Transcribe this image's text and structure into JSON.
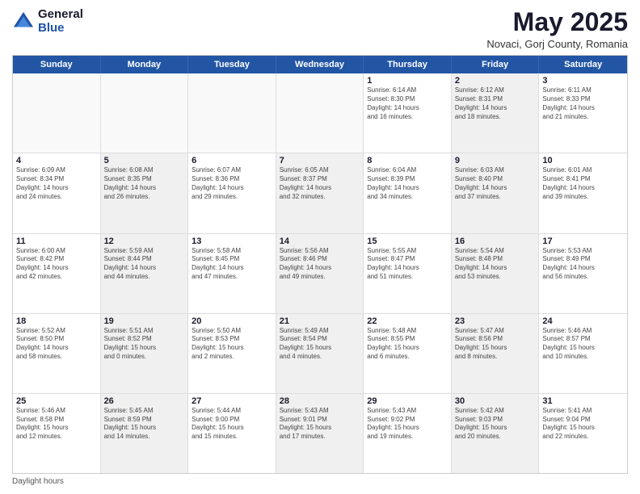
{
  "logo": {
    "general": "General",
    "blue": "Blue"
  },
  "header": {
    "month": "May 2025",
    "location": "Novaci, Gorj County, Romania"
  },
  "weekdays": [
    "Sunday",
    "Monday",
    "Tuesday",
    "Wednesday",
    "Thursday",
    "Friday",
    "Saturday"
  ],
  "footer": {
    "daylight_label": "Daylight hours"
  },
  "weeks": [
    [
      {
        "day": "",
        "info": "",
        "empty": true
      },
      {
        "day": "",
        "info": "",
        "empty": true
      },
      {
        "day": "",
        "info": "",
        "empty": true
      },
      {
        "day": "",
        "info": "",
        "empty": true
      },
      {
        "day": "1",
        "info": "Sunrise: 6:14 AM\nSunset: 8:30 PM\nDaylight: 14 hours\nand 16 minutes.",
        "empty": false,
        "shaded": false
      },
      {
        "day": "2",
        "info": "Sunrise: 6:12 AM\nSunset: 8:31 PM\nDaylight: 14 hours\nand 18 minutes.",
        "empty": false,
        "shaded": true
      },
      {
        "day": "3",
        "info": "Sunrise: 6:11 AM\nSunset: 8:33 PM\nDaylight: 14 hours\nand 21 minutes.",
        "empty": false,
        "shaded": false
      }
    ],
    [
      {
        "day": "4",
        "info": "Sunrise: 6:09 AM\nSunset: 8:34 PM\nDaylight: 14 hours\nand 24 minutes.",
        "empty": false,
        "shaded": false
      },
      {
        "day": "5",
        "info": "Sunrise: 6:08 AM\nSunset: 8:35 PM\nDaylight: 14 hours\nand 26 minutes.",
        "empty": false,
        "shaded": true
      },
      {
        "day": "6",
        "info": "Sunrise: 6:07 AM\nSunset: 8:36 PM\nDaylight: 14 hours\nand 29 minutes.",
        "empty": false,
        "shaded": false
      },
      {
        "day": "7",
        "info": "Sunrise: 6:05 AM\nSunset: 8:37 PM\nDaylight: 14 hours\nand 32 minutes.",
        "empty": false,
        "shaded": true
      },
      {
        "day": "8",
        "info": "Sunrise: 6:04 AM\nSunset: 8:39 PM\nDaylight: 14 hours\nand 34 minutes.",
        "empty": false,
        "shaded": false
      },
      {
        "day": "9",
        "info": "Sunrise: 6:03 AM\nSunset: 8:40 PM\nDaylight: 14 hours\nand 37 minutes.",
        "empty": false,
        "shaded": true
      },
      {
        "day": "10",
        "info": "Sunrise: 6:01 AM\nSunset: 8:41 PM\nDaylight: 14 hours\nand 39 minutes.",
        "empty": false,
        "shaded": false
      }
    ],
    [
      {
        "day": "11",
        "info": "Sunrise: 6:00 AM\nSunset: 8:42 PM\nDaylight: 14 hours\nand 42 minutes.",
        "empty": false,
        "shaded": false
      },
      {
        "day": "12",
        "info": "Sunrise: 5:59 AM\nSunset: 8:44 PM\nDaylight: 14 hours\nand 44 minutes.",
        "empty": false,
        "shaded": true
      },
      {
        "day": "13",
        "info": "Sunrise: 5:58 AM\nSunset: 8:45 PM\nDaylight: 14 hours\nand 47 minutes.",
        "empty": false,
        "shaded": false
      },
      {
        "day": "14",
        "info": "Sunrise: 5:56 AM\nSunset: 8:46 PM\nDaylight: 14 hours\nand 49 minutes.",
        "empty": false,
        "shaded": true
      },
      {
        "day": "15",
        "info": "Sunrise: 5:55 AM\nSunset: 8:47 PM\nDaylight: 14 hours\nand 51 minutes.",
        "empty": false,
        "shaded": false
      },
      {
        "day": "16",
        "info": "Sunrise: 5:54 AM\nSunset: 8:48 PM\nDaylight: 14 hours\nand 53 minutes.",
        "empty": false,
        "shaded": true
      },
      {
        "day": "17",
        "info": "Sunrise: 5:53 AM\nSunset: 8:49 PM\nDaylight: 14 hours\nand 56 minutes.",
        "empty": false,
        "shaded": false
      }
    ],
    [
      {
        "day": "18",
        "info": "Sunrise: 5:52 AM\nSunset: 8:50 PM\nDaylight: 14 hours\nand 58 minutes.",
        "empty": false,
        "shaded": false
      },
      {
        "day": "19",
        "info": "Sunrise: 5:51 AM\nSunset: 8:52 PM\nDaylight: 15 hours\nand 0 minutes.",
        "empty": false,
        "shaded": true
      },
      {
        "day": "20",
        "info": "Sunrise: 5:50 AM\nSunset: 8:53 PM\nDaylight: 15 hours\nand 2 minutes.",
        "empty": false,
        "shaded": false
      },
      {
        "day": "21",
        "info": "Sunrise: 5:49 AM\nSunset: 8:54 PM\nDaylight: 15 hours\nand 4 minutes.",
        "empty": false,
        "shaded": true
      },
      {
        "day": "22",
        "info": "Sunrise: 5:48 AM\nSunset: 8:55 PM\nDaylight: 15 hours\nand 6 minutes.",
        "empty": false,
        "shaded": false
      },
      {
        "day": "23",
        "info": "Sunrise: 5:47 AM\nSunset: 8:56 PM\nDaylight: 15 hours\nand 8 minutes.",
        "empty": false,
        "shaded": true
      },
      {
        "day": "24",
        "info": "Sunrise: 5:46 AM\nSunset: 8:57 PM\nDaylight: 15 hours\nand 10 minutes.",
        "empty": false,
        "shaded": false
      }
    ],
    [
      {
        "day": "25",
        "info": "Sunrise: 5:46 AM\nSunset: 8:58 PM\nDaylight: 15 hours\nand 12 minutes.",
        "empty": false,
        "shaded": false
      },
      {
        "day": "26",
        "info": "Sunrise: 5:45 AM\nSunset: 8:59 PM\nDaylight: 15 hours\nand 14 minutes.",
        "empty": false,
        "shaded": true
      },
      {
        "day": "27",
        "info": "Sunrise: 5:44 AM\nSunset: 9:00 PM\nDaylight: 15 hours\nand 15 minutes.",
        "empty": false,
        "shaded": false
      },
      {
        "day": "28",
        "info": "Sunrise: 5:43 AM\nSunset: 9:01 PM\nDaylight: 15 hours\nand 17 minutes.",
        "empty": false,
        "shaded": true
      },
      {
        "day": "29",
        "info": "Sunrise: 5:43 AM\nSunset: 9:02 PM\nDaylight: 15 hours\nand 19 minutes.",
        "empty": false,
        "shaded": false
      },
      {
        "day": "30",
        "info": "Sunrise: 5:42 AM\nSunset: 9:03 PM\nDaylight: 15 hours\nand 20 minutes.",
        "empty": false,
        "shaded": true
      },
      {
        "day": "31",
        "info": "Sunrise: 5:41 AM\nSunset: 9:04 PM\nDaylight: 15 hours\nand 22 minutes.",
        "empty": false,
        "shaded": false
      }
    ]
  ]
}
